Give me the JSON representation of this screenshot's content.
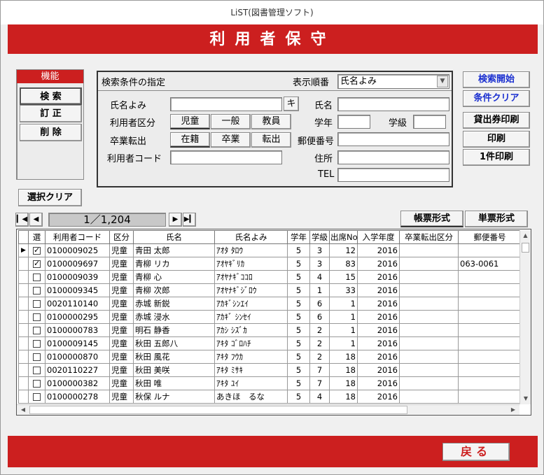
{
  "window": {
    "title": "LiST(図書管理ソフト)"
  },
  "header": {
    "title": "利用者保守"
  },
  "menu": {
    "title": "機能",
    "search": "検 索",
    "edit": "訂 正",
    "delete": "削 除"
  },
  "search": {
    "panel_title": "検索条件の指定",
    "sort_label": "表示順番",
    "sort_value": "氏名よみ",
    "kana_label": "氏名よみ",
    "kana_value": "",
    "kana_button": "キ",
    "name_label": "氏名",
    "type_label": "利用者区分",
    "type_options": [
      "児童",
      "一般",
      "教員"
    ],
    "grade_label": "学年",
    "class_label": "学級",
    "status_label": "卒業転出",
    "status_options": [
      "在籍",
      "卒業",
      "転出"
    ],
    "postal_label": "郵便番号",
    "code_label": "利用者コード",
    "address_label": "住所",
    "tel_label": "TEL"
  },
  "actions": {
    "start_search": "検索開始",
    "clear_conditions": "条件クリア",
    "print_card": "貸出券印刷",
    "print": "印刷",
    "print_one": "1件印刷",
    "clear_selection": "選択クリア",
    "form_list": "帳票形式",
    "form_single": "単票形式",
    "back": "戻る"
  },
  "nav": {
    "position": "1／1,204"
  },
  "table": {
    "headers": [
      "選",
      "利用者コード",
      "区分",
      "氏名",
      "氏名よみ",
      "学年",
      "学級",
      "出席No.",
      "入学年度",
      "卒業転出区分",
      "郵便番号"
    ],
    "rows": [
      {
        "sel": true,
        "code": "0100009025",
        "type": "児童",
        "name": "青田 太郎",
        "kana": "ｱｵﾀ ﾀﾛｳ",
        "grade": "5",
        "cls": "3",
        "no": "12",
        "year": "2016",
        "status": "",
        "postal": ""
      },
      {
        "sel": true,
        "code": "0100009697",
        "type": "児童",
        "name": "青柳 リカ",
        "kana": "ｱｵﾔｷﾞﾘｶ",
        "grade": "5",
        "cls": "3",
        "no": "83",
        "year": "2016",
        "status": "",
        "postal": "063-0061"
      },
      {
        "sel": false,
        "code": "0100009039",
        "type": "児童",
        "name": "青柳 心",
        "kana": "ｱｵﾔﾅｷﾞｺｺﾛ",
        "grade": "5",
        "cls": "4",
        "no": "15",
        "year": "2016",
        "status": "",
        "postal": ""
      },
      {
        "sel": false,
        "code": "0100009345",
        "type": "児童",
        "name": "青柳 次郎",
        "kana": "ｱｵﾔﾅｷﾞｼﾞﾛｳ",
        "grade": "5",
        "cls": "1",
        "no": "33",
        "year": "2016",
        "status": "",
        "postal": ""
      },
      {
        "sel": false,
        "code": "0020110140",
        "type": "児童",
        "name": "赤城 新鋭",
        "kana": "ｱｶｷﾞｼﾝｴｲ",
        "grade": "5",
        "cls": "6",
        "no": "1",
        "year": "2016",
        "status": "",
        "postal": ""
      },
      {
        "sel": false,
        "code": "0100000295",
        "type": "児童",
        "name": "赤城 浸水",
        "kana": "ｱｶｷﾞ ｼﾝｾｲ",
        "grade": "5",
        "cls": "6",
        "no": "1",
        "year": "2016",
        "status": "",
        "postal": ""
      },
      {
        "sel": false,
        "code": "0100000783",
        "type": "児童",
        "name": "明石 静香",
        "kana": "ｱｶｼ ｼｽﾞｶ",
        "grade": "5",
        "cls": "2",
        "no": "1",
        "year": "2016",
        "status": "",
        "postal": ""
      },
      {
        "sel": false,
        "code": "0100009145",
        "type": "児童",
        "name": "秋田 五郎八",
        "kana": "ｱｷﾀ ｺﾞﾛﾊﾁ",
        "grade": "5",
        "cls": "2",
        "no": "1",
        "year": "2016",
        "status": "",
        "postal": ""
      },
      {
        "sel": false,
        "code": "0100000870",
        "type": "児童",
        "name": "秋田 風花",
        "kana": "ｱｷﾀ ﾌｳｶ",
        "grade": "5",
        "cls": "2",
        "no": "18",
        "year": "2016",
        "status": "",
        "postal": ""
      },
      {
        "sel": false,
        "code": "0020110227",
        "type": "児童",
        "name": "秋田 美咲",
        "kana": "ｱｷﾀ ﾐｻｷ",
        "grade": "5",
        "cls": "7",
        "no": "18",
        "year": "2016",
        "status": "",
        "postal": ""
      },
      {
        "sel": false,
        "code": "0100000382",
        "type": "児童",
        "name": "秋田 唯",
        "kana": "ｱｷﾀ ﾕｲ",
        "grade": "5",
        "cls": "7",
        "no": "18",
        "year": "2016",
        "status": "",
        "postal": ""
      },
      {
        "sel": false,
        "code": "0100000278",
        "type": "児童",
        "name": "秋保 ルナ",
        "kana": "あきほ　るな",
        "grade": "5",
        "cls": "4",
        "no": "18",
        "year": "2016",
        "status": "",
        "postal": ""
      }
    ]
  },
  "colors": {
    "brand_red": "#cc1f1f",
    "link_blue": "#1a2fd0"
  }
}
